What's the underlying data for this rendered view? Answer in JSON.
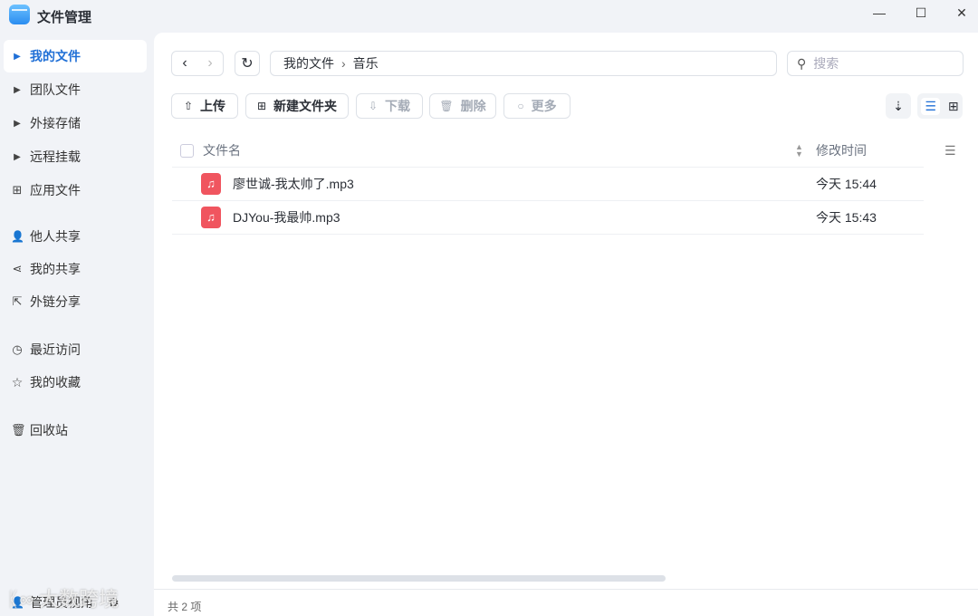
{
  "app": {
    "title": "文件管理"
  },
  "sidebar": {
    "items": [
      {
        "label": "我的文件",
        "icon": "caret-right-icon"
      },
      {
        "label": "团队文件",
        "icon": "caret-right-icon"
      },
      {
        "label": "外接存储",
        "icon": "caret-right-icon"
      },
      {
        "label": "远程挂载",
        "icon": "caret-right-icon"
      },
      {
        "label": "应用文件",
        "icon": "grid-icon"
      },
      {
        "label": "他人共享",
        "icon": "users-icon"
      },
      {
        "label": "我的共享",
        "icon": "share-icon"
      },
      {
        "label": "外链分享",
        "icon": "external-link-icon"
      },
      {
        "label": "最近访问",
        "icon": "clock-icon"
      },
      {
        "label": "我的收藏",
        "icon": "star-icon"
      },
      {
        "label": "回收站",
        "icon": "trash-icon"
      }
    ],
    "admin_view": "管理员视角"
  },
  "watermark": "大数跨境",
  "breadcrumb": [
    "我的文件",
    "音乐"
  ],
  "search": {
    "placeholder": "搜索"
  },
  "toolbar": {
    "upload": "上传",
    "new_folder": "新建文件夹",
    "download": "下载",
    "delete": "删除",
    "more": "更多"
  },
  "table": {
    "col_name": "文件名",
    "col_time": "修改时间",
    "rows": [
      {
        "name": "廖世诚-我太帅了.mp3",
        "time": "今天 15:44"
      },
      {
        "name": "DJYou-我最帅.mp3",
        "time": "今天 15:43"
      }
    ]
  },
  "footer": {
    "count": "共 2 项"
  },
  "colors": {
    "accent": "#1f6fd6",
    "file_icon": "#f0555f"
  }
}
